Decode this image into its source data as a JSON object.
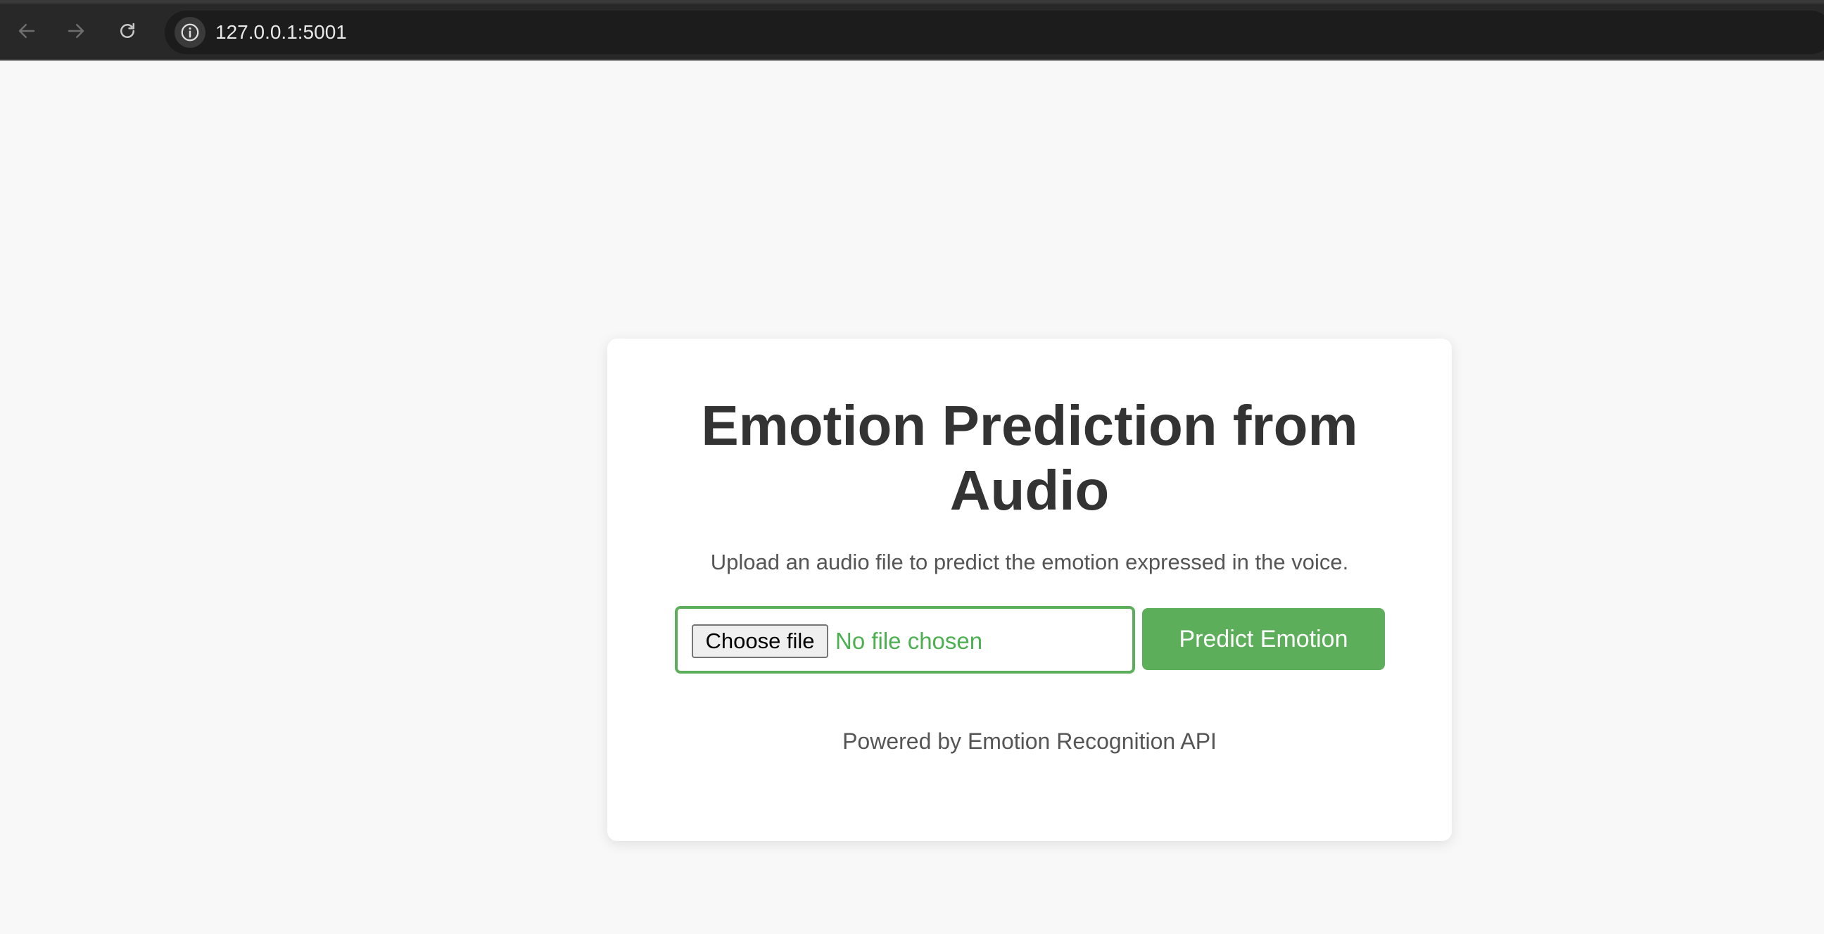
{
  "browser": {
    "url": "127.0.0.1:5001",
    "icons": {
      "back": "arrow-left-icon",
      "forward": "arrow-right-icon",
      "reload": "reload-icon",
      "site_info": "info-icon"
    }
  },
  "card": {
    "title": "Emotion Prediction from Audio",
    "subtitle": "Upload an audio file to predict the emotion expressed in the voice.",
    "file_input": {
      "button_label": "Choose file",
      "status_text": "No file chosen"
    },
    "predict_button_label": "Predict Emotion",
    "footer": "Powered by Emotion Recognition API"
  },
  "colors": {
    "accent": "#5cae5b",
    "status_text": "#4caf50",
    "page_bg": "#f8f8f8",
    "title": "#333333",
    "browser_bar": "#282828"
  }
}
